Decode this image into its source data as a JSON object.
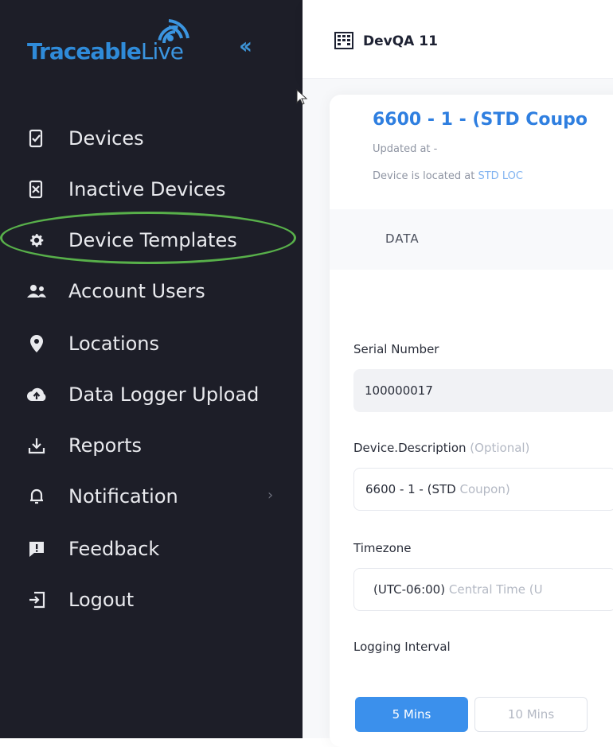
{
  "sidebar": {
    "logo": {
      "main": "Traceable",
      "accent": "Live"
    },
    "collapse_icon": "double-chevron-left-icon",
    "items": [
      {
        "label": "Devices",
        "icon": "device-check-icon"
      },
      {
        "label": "Inactive Devices",
        "icon": "device-x-icon"
      },
      {
        "label": "Device Templates",
        "icon": "gear-icon",
        "highlighted": true
      },
      {
        "label": "Account Users",
        "icon": "users-icon"
      },
      {
        "label": "Locations",
        "icon": "map-pin-icon"
      },
      {
        "label": "Data Logger Upload",
        "icon": "cloud-upload-icon"
      },
      {
        "label": "Reports",
        "icon": "download-icon"
      },
      {
        "label": "Notification",
        "icon": "bell-icon",
        "chevron": "›"
      },
      {
        "label": "Feedback",
        "icon": "feedback-icon"
      },
      {
        "label": "Logout",
        "icon": "logout-icon"
      }
    ]
  },
  "header": {
    "tenant": "DevQA 11",
    "icon": "building-icon"
  },
  "device": {
    "title": "6600 - 1 - (STD Coupo",
    "updated": "Updated at -",
    "located_prefix": "Device is located at",
    "located_value": "STD LOC"
  },
  "tabs": {
    "active": "DATA"
  },
  "form": {
    "serial_label": "Serial Number",
    "serial_value": "100000017",
    "desc_label": "Device.Description",
    "desc_optional": "(Optional)",
    "desc_value_main": "6600 - 1 - (STD",
    "desc_value_faded": "Coupon)",
    "tz_label": "Timezone",
    "tz_value_main": "(UTC-06:00)",
    "tz_value_faded": "Central Time (U",
    "interval_label": "Logging Interval",
    "interval_options": [
      "5 Mins",
      "10 Mins"
    ],
    "interval_selected": "5 Mins"
  },
  "colors": {
    "sidebar_bg": "#1d1e28",
    "accent": "#3b90ec",
    "highlight": "#58b04a"
  }
}
